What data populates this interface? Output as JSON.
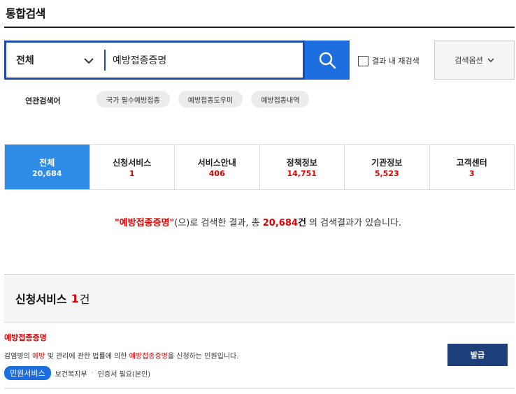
{
  "page": {
    "title": "통합검색"
  },
  "search": {
    "scope_label": "전체",
    "query": "예방접종증명",
    "in_result_label": "결과 내 재검색",
    "options_label": "검색옵션"
  },
  "related": {
    "label": "연관검색어",
    "tags": [
      "국가 필수예방접종",
      "예방접종도우미",
      "예방접종내역"
    ]
  },
  "tabs": [
    {
      "label": "전체",
      "count": "20,684",
      "active": true
    },
    {
      "label": "신청서비스",
      "count": "1",
      "active": false
    },
    {
      "label": "서비스안내",
      "count": "406",
      "active": false
    },
    {
      "label": "정책정보",
      "count": "14,751",
      "active": false
    },
    {
      "label": "기관정보",
      "count": "5,523",
      "active": false
    },
    {
      "label": "고객센터",
      "count": "3",
      "active": false
    }
  ],
  "summary": {
    "keyword": "\"예방접종증명\"",
    "pre": "(으)로 검색한 결과, 총 ",
    "total": "20,684",
    "unit": "건",
    "post": " 의 검색결과가 있습니다."
  },
  "section": {
    "title": "신청서비스",
    "count": "1",
    "unit": "건"
  },
  "result": {
    "title": "예방접종증명",
    "desc_parts": [
      {
        "text": "감염병의 ",
        "hl": false
      },
      {
        "text": "예방",
        "hl": true
      },
      {
        "text": " 및 관리에 관한 법률에 의한 ",
        "hl": false
      },
      {
        "text": "예방접종증명",
        "hl": true
      },
      {
        "text": "을 신청하는 민원입니다.",
        "hl": false
      }
    ],
    "badge": "민원서비스",
    "agency": "보건복지부",
    "separator": "·",
    "cert": "인증서 필요(본인)",
    "action_label": "발급"
  },
  "colors": {
    "accent": "#1d49a7",
    "tab_active": "#2f8ce6",
    "highlight": "#e30000",
    "issue_button": "#1d3f7a"
  },
  "icons": {
    "search": "search-icon",
    "chevron": "chevron-down-icon"
  }
}
